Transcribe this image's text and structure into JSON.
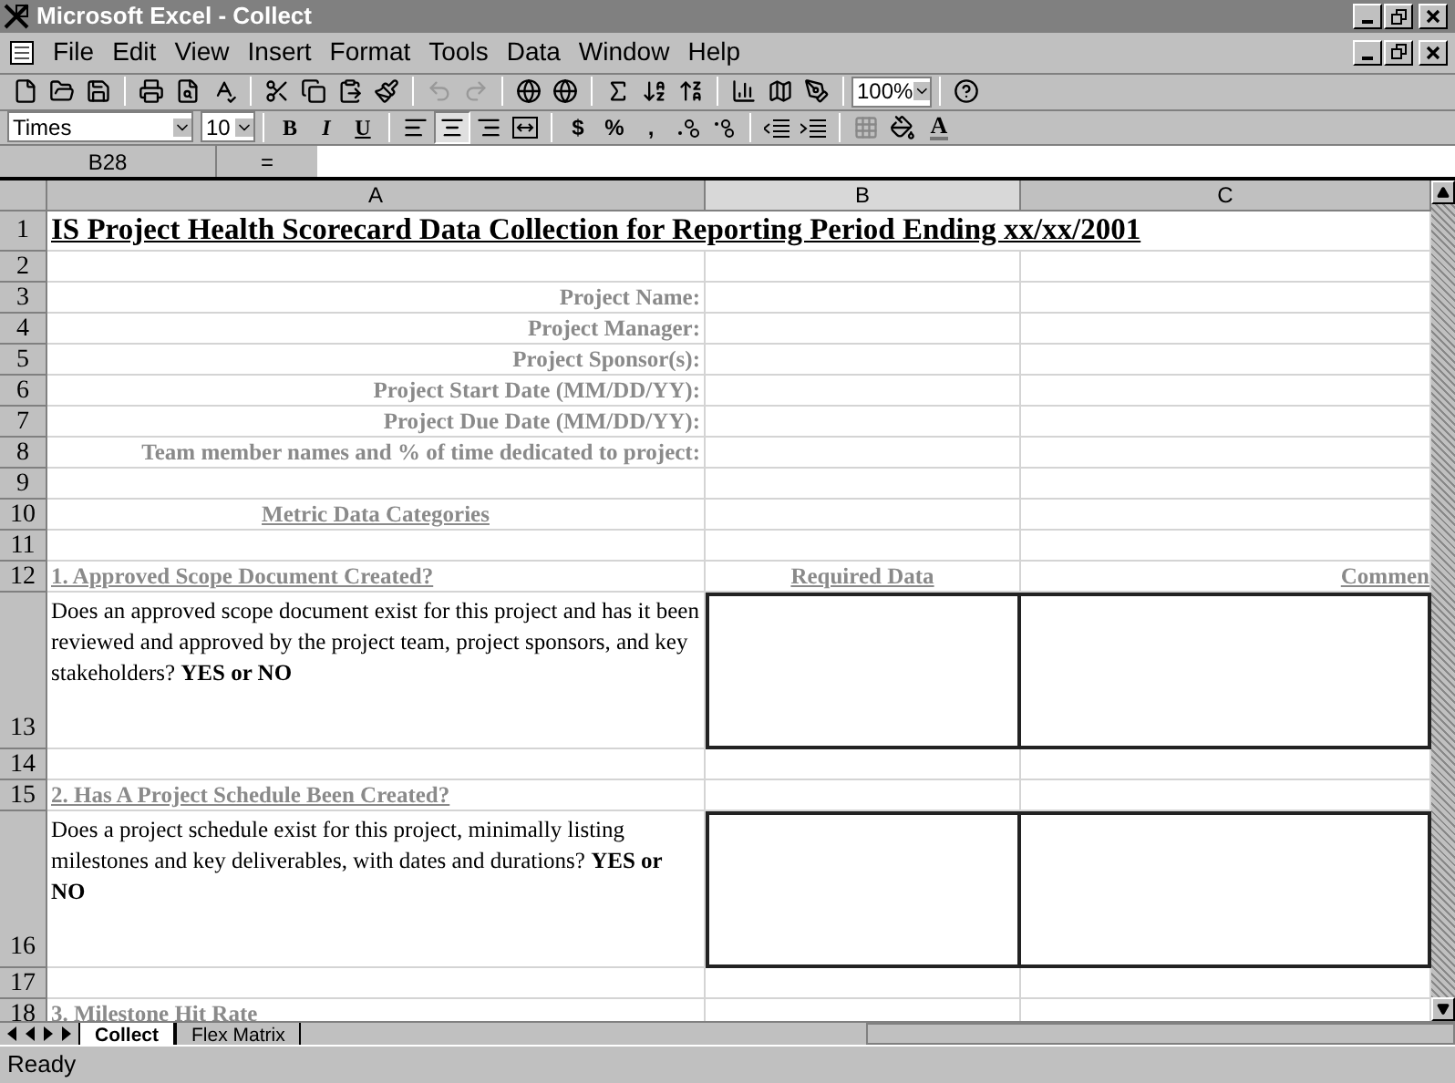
{
  "window": {
    "title": "Microsoft Excel - Collect"
  },
  "menu": [
    "File",
    "Edit",
    "View",
    "Insert",
    "Format",
    "Tools",
    "Data",
    "Window",
    "Help"
  ],
  "zoom": "100%",
  "format_toolbar": {
    "font": "Times",
    "size": "10",
    "bold": "B",
    "italic": "I",
    "underline": "U",
    "currency": "$",
    "percent": "%",
    "comma": ",",
    "font_color": "A",
    "align": [
      {
        "kind": "left",
        "selected": false
      },
      {
        "kind": "center",
        "selected": true
      },
      {
        "kind": "right",
        "selected": false
      }
    ]
  },
  "formula_bar": {
    "name_box": "B28",
    "equals": "="
  },
  "columns": [
    {
      "label": "A",
      "selected": false
    },
    {
      "label": "B",
      "selected": true
    },
    {
      "label": "C",
      "selected": false
    }
  ],
  "rows": [
    {
      "number": "1",
      "kind": "title",
      "a": "IS Project Health Scorecard Data Collection for Reporting Period Ending xx/xx/2001"
    },
    {
      "number": "2",
      "kind": "blank"
    },
    {
      "number": "3",
      "kind": "label",
      "a": "Project Name:"
    },
    {
      "number": "4",
      "kind": "label",
      "a": "Project Manager:"
    },
    {
      "number": "5",
      "kind": "label",
      "a": "Project Sponsor(s):"
    },
    {
      "number": "6",
      "kind": "label",
      "a": "Project Start Date (MM/DD/YY):"
    },
    {
      "number": "7",
      "kind": "label",
      "a": "Project Due Date (MM/DD/YY):"
    },
    {
      "number": "8",
      "kind": "label",
      "a": "Team member names and % of time dedicated to project:"
    },
    {
      "number": "9",
      "kind": "blank"
    },
    {
      "number": "10",
      "kind": "category",
      "a": "Metric Data Categories"
    },
    {
      "number": "11",
      "kind": "blank"
    },
    {
      "number": "12",
      "kind": "question",
      "a": "1. Approved Scope Document Created?",
      "b": "Required Data",
      "c": "Commen"
    },
    {
      "number": "13",
      "kind": "body",
      "a": "Does an approved scope document exist for this project and has it been reviewed and approved by the project team, project sponsors, and key stakeholders?  **YES or NO**"
    },
    {
      "number": "14",
      "kind": "blank"
    },
    {
      "number": "15",
      "kind": "question",
      "a": "2. Has A Project Schedule Been Created?"
    },
    {
      "number": "16",
      "kind": "body",
      "a": "Does a project schedule exist for this project, minimally listing milestones and key deliverables, with dates and durations?  **YES or NO**"
    },
    {
      "number": "17",
      "kind": "blank"
    },
    {
      "number": "18",
      "kind": "question",
      "a": "3. Milestone Hit Rate"
    }
  ],
  "sheet_tabs": [
    {
      "label": "Collect",
      "selected": true
    },
    {
      "label": "Flex Matrix",
      "selected": false
    }
  ],
  "status_bar": {
    "text": "Ready"
  }
}
